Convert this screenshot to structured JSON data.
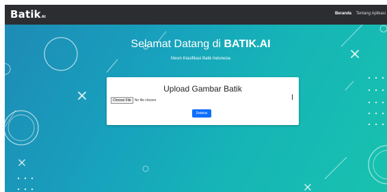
{
  "navbar": {
    "brand": "Batik",
    "brand_suffix": "AI",
    "links": [
      {
        "label": "Beranda",
        "active": true
      },
      {
        "label": "Tentang Aplikasi",
        "active": false
      }
    ]
  },
  "hero": {
    "title_prefix": "Selamat Datang di ",
    "title_highlight": "BATIK.AI",
    "subtitle": "Mesin Klasifikasi Batik Indonesia"
  },
  "upload": {
    "title": "Upload Gambar Batik",
    "file_button": "Choose File",
    "file_status": "No file chosen",
    "submit_label": "Deteksi"
  },
  "colors": {
    "navbar": "#2b2d31",
    "hero_start": "#1e8bb6",
    "hero_end": "#17c2ae",
    "primary_button": "#0d6efd"
  },
  "icons": [
    "ring-decoration",
    "cross-decoration",
    "dot-grid-decoration",
    "line-decoration"
  ]
}
